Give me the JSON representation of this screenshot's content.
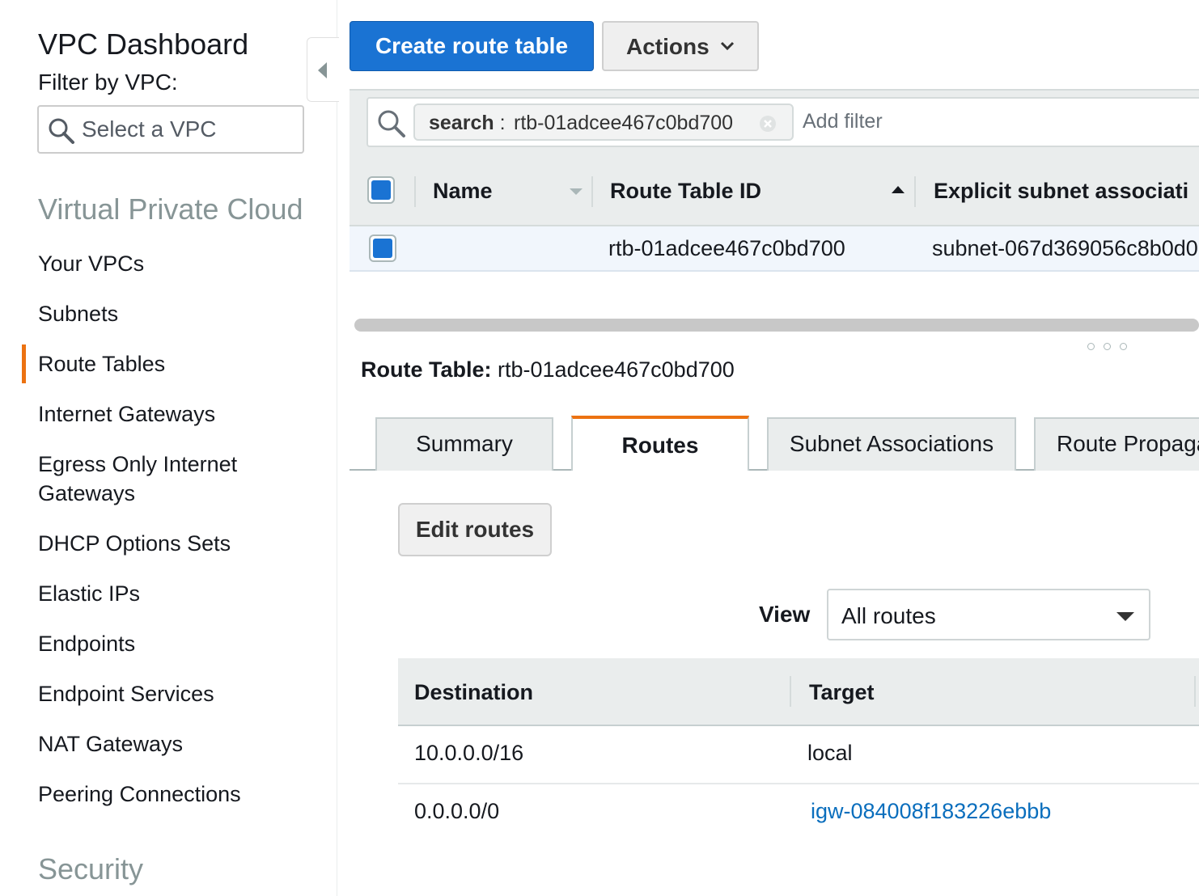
{
  "sidebar": {
    "title": "VPC Dashboard",
    "filter_label": "Filter by VPC:",
    "vpc_select_placeholder": "Select a VPC",
    "section_vpc": "Virtual Private Cloud",
    "items": [
      {
        "label": "Your VPCs"
      },
      {
        "label": "Subnets"
      },
      {
        "label": "Route Tables",
        "active": true
      },
      {
        "label": "Internet Gateways"
      },
      {
        "label": "Egress Only Internet Gateways"
      },
      {
        "label": "DHCP Options Sets"
      },
      {
        "label": "Elastic IPs"
      },
      {
        "label": "Endpoints"
      },
      {
        "label": "Endpoint Services"
      },
      {
        "label": "NAT Gateways"
      },
      {
        "label": "Peering Connections"
      }
    ],
    "section_security": "Security"
  },
  "toolbar": {
    "create_label": "Create route table",
    "actions_label": "Actions"
  },
  "filter": {
    "token_key": "search",
    "token_sep": " : ",
    "token_value": "rtb-01adcee467c0bd700",
    "add_filter_placeholder": "Add filter"
  },
  "grid": {
    "columns": [
      "Name",
      "Route Table ID",
      "Explicit subnet associati"
    ],
    "rows": [
      {
        "name": "",
        "route_table_id": "rtb-01adcee467c0bd700",
        "subnet": "subnet-067d369056c8b0d0",
        "selected": true
      }
    ]
  },
  "detail": {
    "label": "Route Table:",
    "route_table_id": "rtb-01adcee467c0bd700",
    "tabs": [
      {
        "label": "Summary"
      },
      {
        "label": "Routes",
        "active": true
      },
      {
        "label": "Subnet Associations"
      },
      {
        "label": "Route Propaga"
      }
    ],
    "edit_routes_label": "Edit routes",
    "view_label": "View",
    "view_value": "All routes",
    "routes_columns": [
      "Destination",
      "Target"
    ],
    "routes": [
      {
        "destination": "10.0.0.0/16",
        "target": "local",
        "target_is_link": false
      },
      {
        "destination": "0.0.0.0/0",
        "target": "igw-084008f183226ebbb",
        "target_is_link": true
      }
    ]
  },
  "colors": {
    "primary_button": "#1a73d3",
    "active_accent": "#ec7211",
    "link": "#0a6ebd",
    "selected_row": "#f1f6fc"
  }
}
